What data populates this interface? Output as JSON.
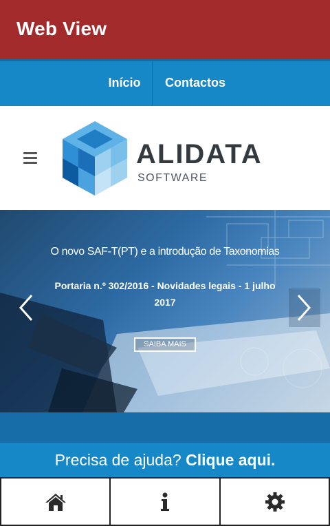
{
  "appbar": {
    "title": "Web View"
  },
  "topnav": {
    "items": [
      {
        "label": "Início"
      },
      {
        "label": "Contactos"
      }
    ]
  },
  "header": {
    "menu_icon": "hamburger-menu-icon",
    "logo": {
      "name": "ALIDATA",
      "subtitle": "SOFTWARE"
    }
  },
  "hero": {
    "title": "O novo SAF-T(PT) e a introdução de Taxonomias",
    "subtitle": "Portaria n.º 302/2016 - Novidades legais - 1 julho 2017",
    "button_label": "SAIBA MAIS",
    "prev_icon": "chevron-left-icon",
    "next_icon": "chevron-right-icon"
  },
  "help": {
    "text": "Precisa de ajuda?",
    "link": "Clique aqui."
  },
  "bottom_tabs": [
    {
      "icon": "home-icon"
    },
    {
      "icon": "info-icon"
    },
    {
      "icon": "gear-icon"
    }
  ],
  "colors": {
    "appbar": "#a32a2a",
    "nav": "#1788c7",
    "nav_dark": "#166da8",
    "logo_text": "#333a40"
  }
}
